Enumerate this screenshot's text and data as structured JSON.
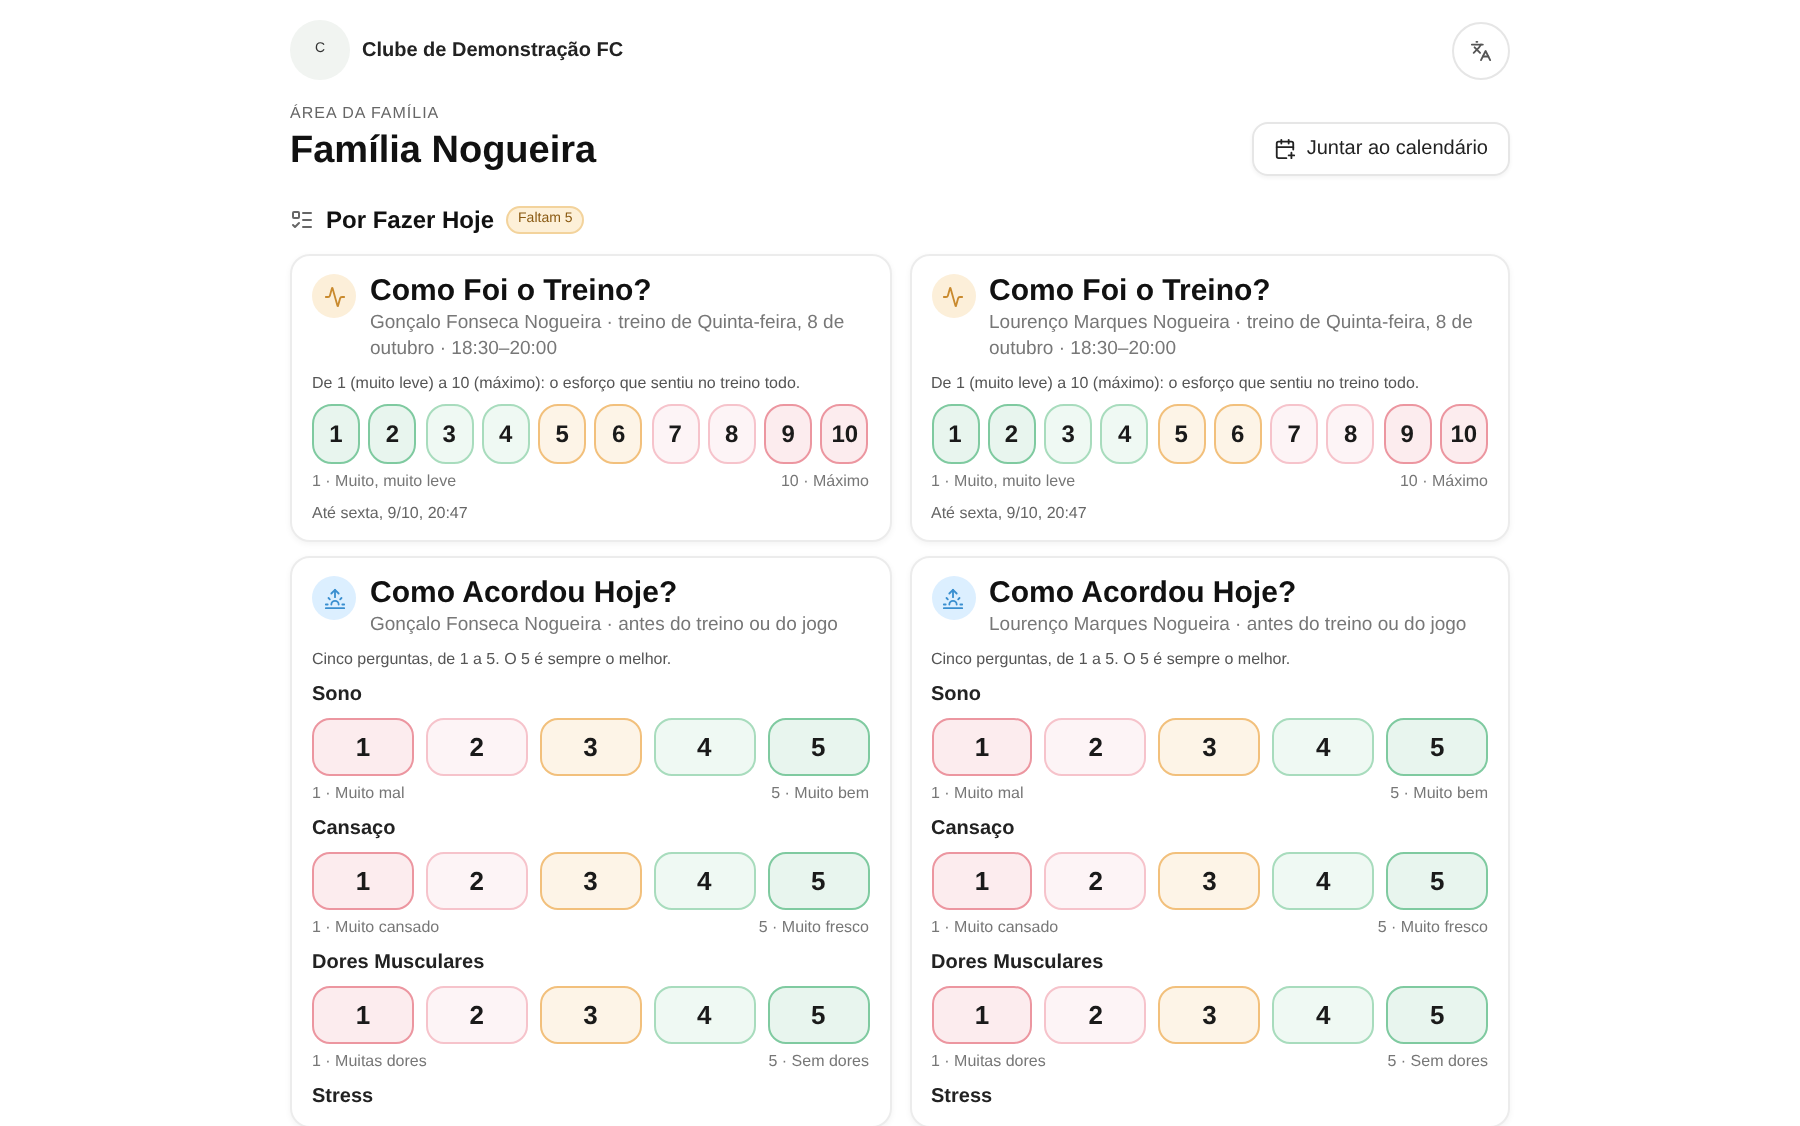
{
  "header": {
    "logo_letter": "C",
    "club": "Clube de Demonstração FC"
  },
  "eyebrow": "ÁREA DA FAMÍLIA",
  "family": "Família Nogueira",
  "calendar_button": "Juntar ao calendário",
  "todo": {
    "title": "Por Fazer Hoje",
    "badge": "Faltam 5"
  },
  "cards": [
    {
      "kind": "effort",
      "title": "Como Foi o Treino?",
      "subtitle": "Gonçalo Fonseca Nogueira · treino de Quinta-feira, 8 de outubro · 18:30–20:00",
      "instructions": "De 1 (muito leve) a 10 (máximo): o esforço que sentiu no treino todo.",
      "options": [
        {
          "label": "1",
          "color": "#7fcaa0"
        },
        {
          "label": "2",
          "color": "#7fcaa0"
        },
        {
          "label": "3",
          "color": "#a8dcbd"
        },
        {
          "label": "4",
          "color": "#a8dcbd"
        },
        {
          "label": "5",
          "color": "#f2c07c"
        },
        {
          "label": "6",
          "color": "#f2c07c"
        },
        {
          "label": "7",
          "color": "#f6c3cb"
        },
        {
          "label": "8",
          "color": "#f6c3cb"
        },
        {
          "label": "9",
          "color": "#ec96a0"
        },
        {
          "label": "10",
          "color": "#ec96a0"
        }
      ],
      "min_label": "1 · Muito, muito leve",
      "max_label": "10 · Máximo",
      "deadline": "Até sexta, 9/10, 20:47"
    },
    {
      "kind": "effort",
      "title": "Como Foi o Treino?",
      "subtitle": "Lourenço Marques Nogueira · treino de Quinta-feira, 8 de outubro · 18:30–20:00",
      "instructions": "De 1 (muito leve) a 10 (máximo): o esforço que sentiu no treino todo.",
      "options": [
        {
          "label": "1",
          "color": "#7fcaa0"
        },
        {
          "label": "2",
          "color": "#7fcaa0"
        },
        {
          "label": "3",
          "color": "#a8dcbd"
        },
        {
          "label": "4",
          "color": "#a8dcbd"
        },
        {
          "label": "5",
          "color": "#f2c07c"
        },
        {
          "label": "6",
          "color": "#f2c07c"
        },
        {
          "label": "7",
          "color": "#f6c3cb"
        },
        {
          "label": "8",
          "color": "#f6c3cb"
        },
        {
          "label": "9",
          "color": "#ec96a0"
        },
        {
          "label": "10",
          "color": "#ec96a0"
        }
      ],
      "min_label": "1 · Muito, muito leve",
      "max_label": "10 · Máximo",
      "deadline": "Até sexta, 9/10, 20:47"
    },
    {
      "kind": "wellness",
      "title": "Como Acordou Hoje?",
      "subtitle": "Gonçalo Fonseca Nogueira · antes do treino ou do jogo",
      "instructions": "Cinco perguntas, de 1 a 5. O 5 é sempre o melhor.",
      "questions": [
        {
          "title": "Sono",
          "options": [
            {
              "label": "1",
              "color": "#ec96a0"
            },
            {
              "label": "2",
              "color": "#f6c3cb"
            },
            {
              "label": "3",
              "color": "#f2c07c"
            },
            {
              "label": "4",
              "color": "#a8dcbd"
            },
            {
              "label": "5",
              "color": "#7fcaa0"
            }
          ],
          "min_label": "1 · Muito mal",
          "max_label": "5 · Muito bem"
        },
        {
          "title": "Cansaço",
          "options": [
            {
              "label": "1",
              "color": "#ec96a0"
            },
            {
              "label": "2",
              "color": "#f6c3cb"
            },
            {
              "label": "3",
              "color": "#f2c07c"
            },
            {
              "label": "4",
              "color": "#a8dcbd"
            },
            {
              "label": "5",
              "color": "#7fcaa0"
            }
          ],
          "min_label": "1 · Muito cansado",
          "max_label": "5 · Muito fresco"
        },
        {
          "title": "Dores Musculares",
          "options": [
            {
              "label": "1",
              "color": "#ec96a0"
            },
            {
              "label": "2",
              "color": "#f6c3cb"
            },
            {
              "label": "3",
              "color": "#f2c07c"
            },
            {
              "label": "4",
              "color": "#a8dcbd"
            },
            {
              "label": "5",
              "color": "#7fcaa0"
            }
          ],
          "min_label": "1 · Muitas dores",
          "max_label": "5 · Sem dores"
        },
        {
          "title": "Stress"
        }
      ]
    },
    {
      "kind": "wellness",
      "title": "Como Acordou Hoje?",
      "subtitle": "Lourenço Marques Nogueira · antes do treino ou do jogo",
      "instructions": "Cinco perguntas, de 1 a 5. O 5 é sempre o melhor.",
      "questions": [
        {
          "title": "Sono",
          "options": [
            {
              "label": "1",
              "color": "#ec96a0"
            },
            {
              "label": "2",
              "color": "#f6c3cb"
            },
            {
              "label": "3",
              "color": "#f2c07c"
            },
            {
              "label": "4",
              "color": "#a8dcbd"
            },
            {
              "label": "5",
              "color": "#7fcaa0"
            }
          ],
          "min_label": "1 · Muito mal",
          "max_label": "5 · Muito bem"
        },
        {
          "title": "Cansaço",
          "options": [
            {
              "label": "1",
              "color": "#ec96a0"
            },
            {
              "label": "2",
              "color": "#f6c3cb"
            },
            {
              "label": "3",
              "color": "#f2c07c"
            },
            {
              "label": "4",
              "color": "#a8dcbd"
            },
            {
              "label": "5",
              "color": "#7fcaa0"
            }
          ],
          "min_label": "1 · Muito cansado",
          "max_label": "5 · Muito fresco"
        },
        {
          "title": "Dores Musculares",
          "options": [
            {
              "label": "1",
              "color": "#ec96a0"
            },
            {
              "label": "2",
              "color": "#f6c3cb"
            },
            {
              "label": "3",
              "color": "#f2c07c"
            },
            {
              "label": "4",
              "color": "#a8dcbd"
            },
            {
              "label": "5",
              "color": "#7fcaa0"
            }
          ],
          "min_label": "1 · Muitas dores",
          "max_label": "5 · Sem dores"
        },
        {
          "title": "Stress"
        }
      ]
    }
  ]
}
